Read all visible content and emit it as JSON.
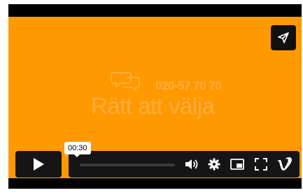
{
  "video": {
    "brand_phone": "020-57 70 70",
    "brand_title": "Rätt att välja",
    "background_color": "#ff9900"
  },
  "player": {
    "current_time": "00:30",
    "progress_fraction": 0.0,
    "icons": {
      "share": "share-paper-plane-icon",
      "play": "play-icon",
      "volume": "volume-icon",
      "settings": "gear-icon",
      "pip": "picture-in-picture-icon",
      "fullscreen": "fullscreen-icon",
      "vimeo": "vimeo-logo-icon"
    }
  }
}
